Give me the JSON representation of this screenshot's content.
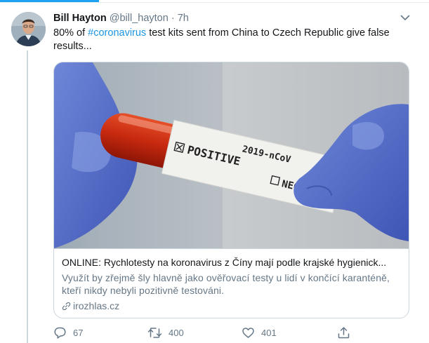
{
  "tweet": {
    "display_name": "Bill Hayton",
    "handle": "@bill_hayton",
    "separator": "·",
    "time": "7h",
    "text_prefix": "80% of ",
    "hashtag": "#coronavirus",
    "text_suffix": " test kits sent from China to Czech Republic give false results..."
  },
  "card": {
    "image_tube_label": "2019-nCoV",
    "image_positive_label": "POSITIVE",
    "image_negative_label": "NEGATIVE",
    "title": "ONLINE: Rychlotesty na koronavirus z Číny mají podle krajské hygienick...",
    "description": "Využít by zřejmě šly hlavně jako ověřovací testy u lidí v končící karanténě, kteří nikdy nebyli pozitivně testováni.",
    "domain": "irozhlas.cz"
  },
  "actions": {
    "reply_count": "67",
    "retweet_count": "400",
    "like_count": "401"
  },
  "colors": {
    "accent": "#1da1f2",
    "link": "#1b95e0",
    "secondary_text": "#657786",
    "border": "#ccd6dd"
  },
  "icons": [
    "chevron-down-icon",
    "link-icon",
    "reply-icon",
    "retweet-icon",
    "like-icon",
    "share-icon"
  ]
}
